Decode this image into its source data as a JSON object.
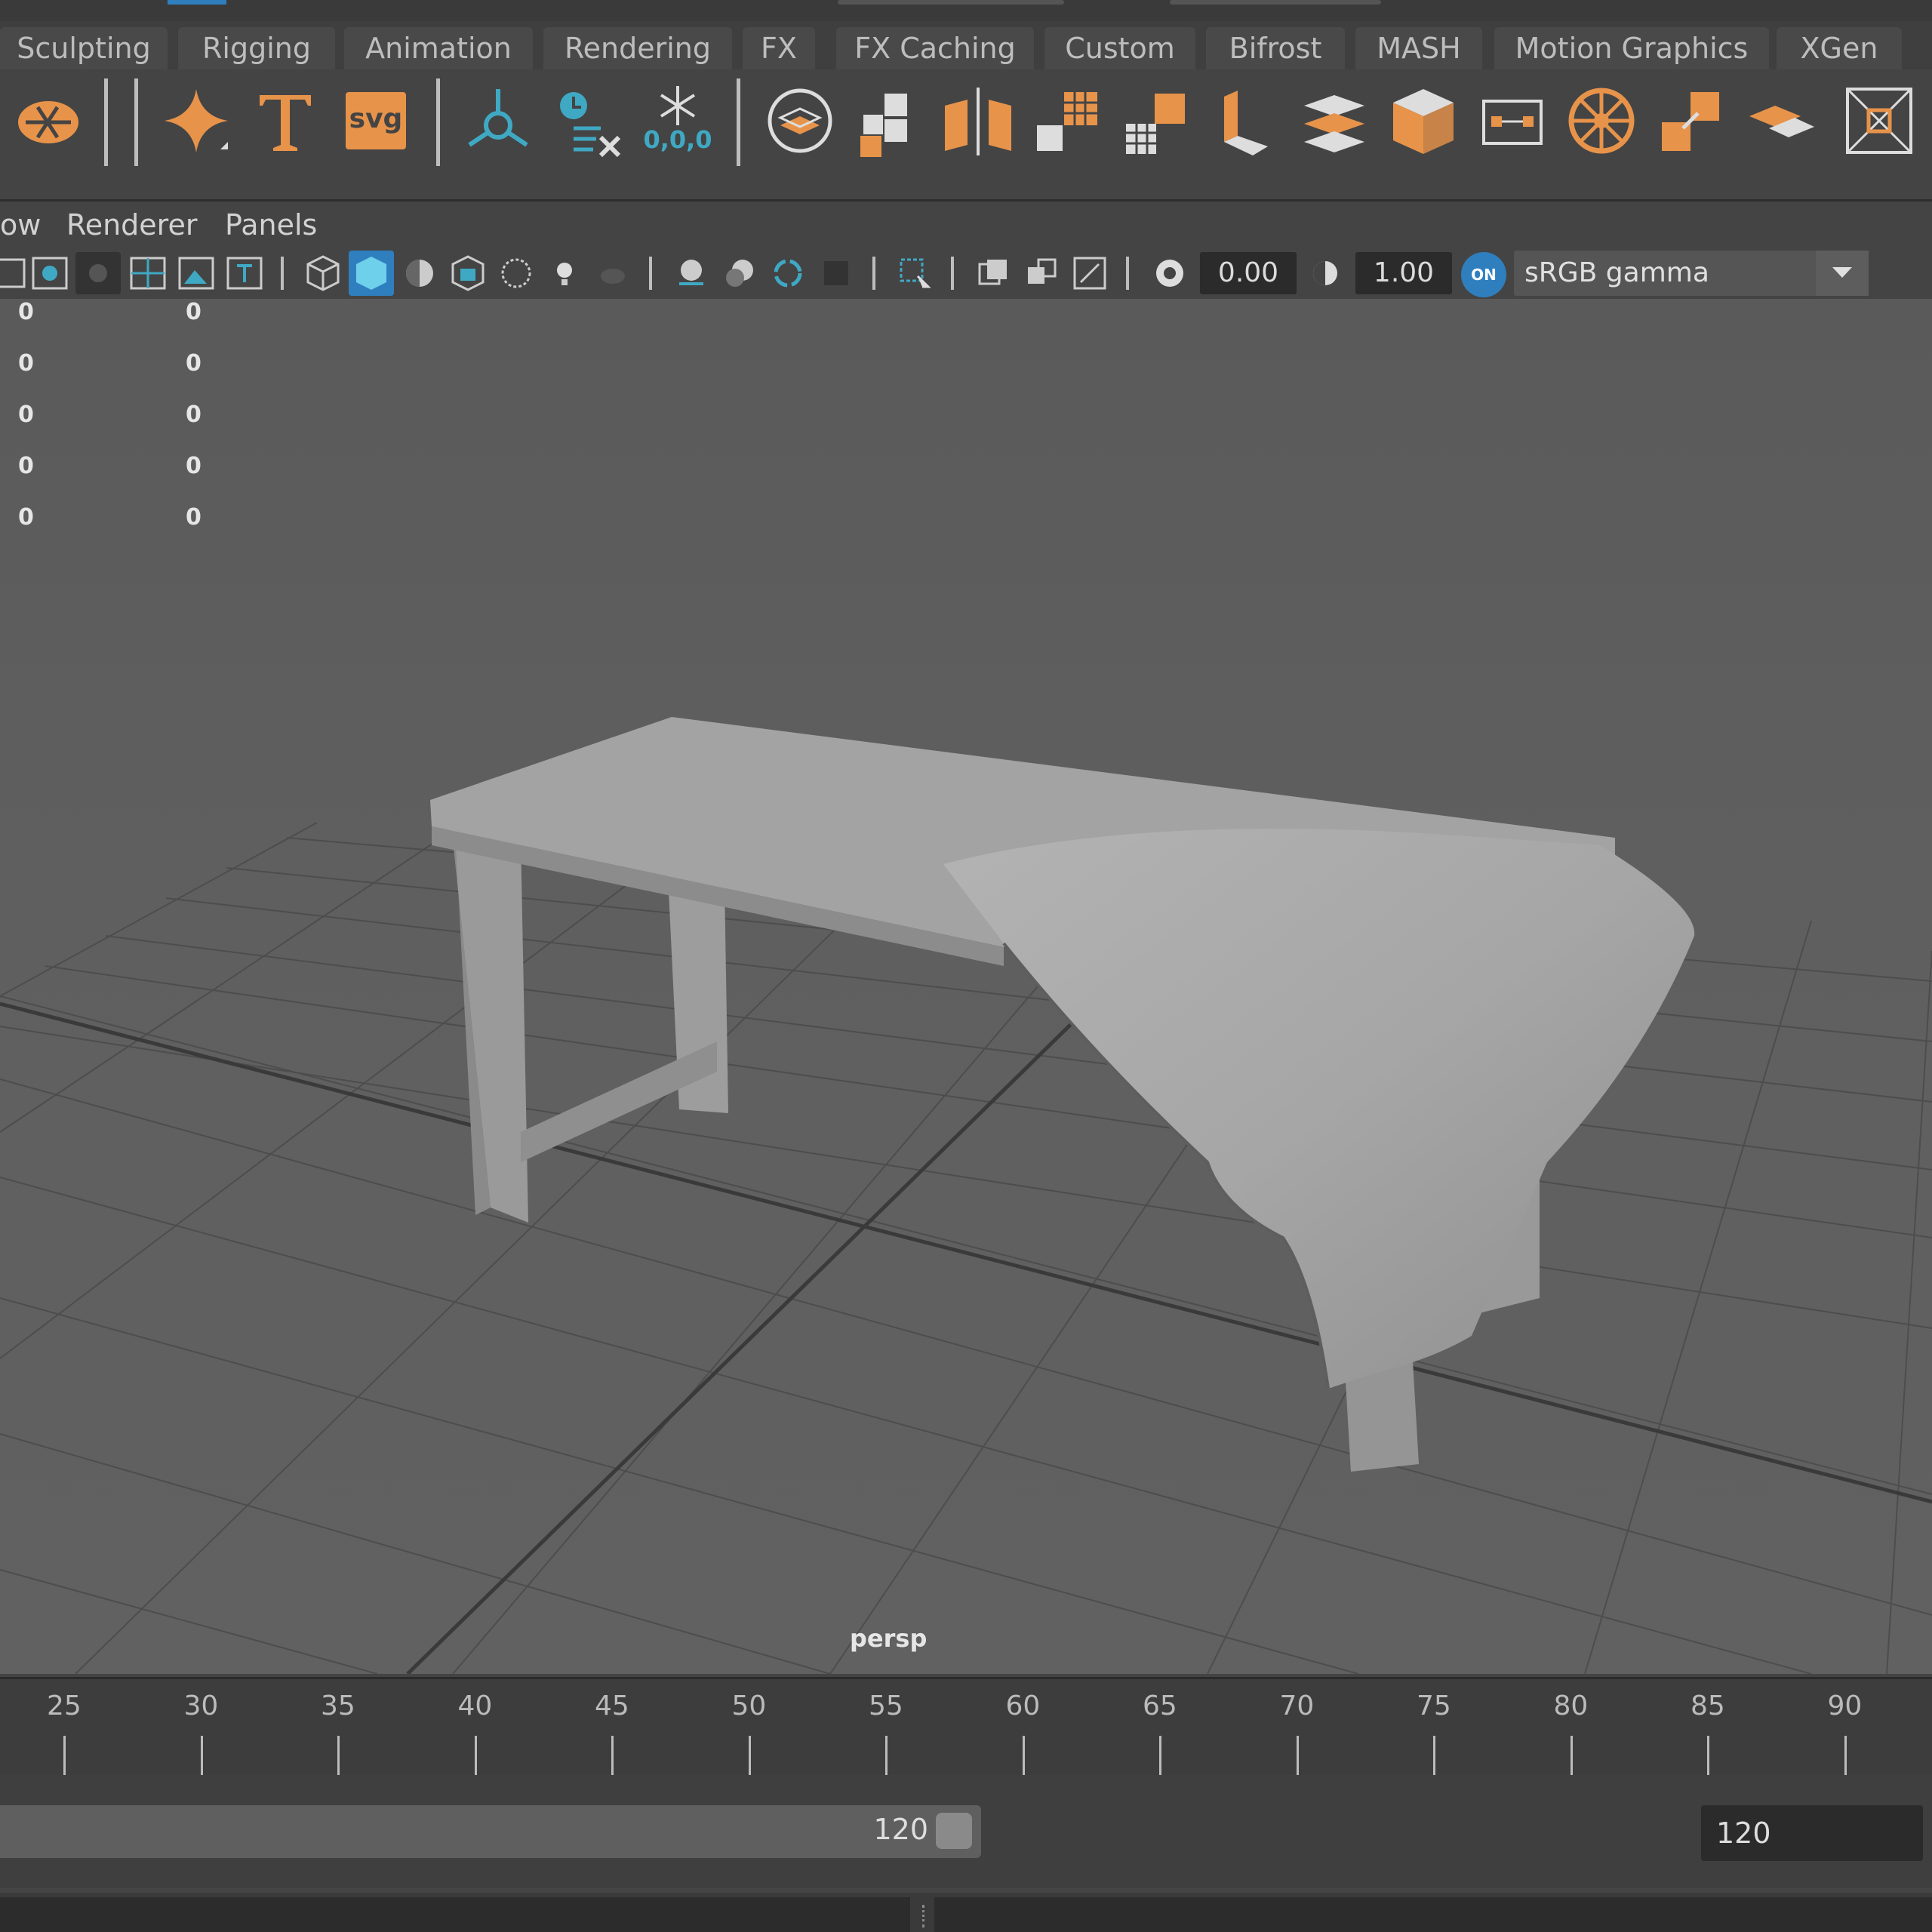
{
  "shelf_tabs": [
    "Sculpting",
    "Rigging",
    "Animation",
    "Rendering",
    "FX",
    "FX Caching",
    "Custom",
    "Bifrost",
    "MASH",
    "Motion Graphics",
    "XGen"
  ],
  "shelf_icons": [
    "sculpt-icon",
    "divider",
    "star-sparkle-icon",
    "text-type-icon",
    "svg-icon",
    "divider",
    "locator-icon",
    "clock-delete-icon",
    "snowflake-freeze-icon",
    "divider",
    "layer-sphere-icon",
    "tiles-icon",
    "mirror-cubes-icon",
    "grid-duplicate-icon",
    "stair-grid-icon",
    "extrude-column-icon",
    "stacked-planes-icon",
    "cube-icon",
    "bounding-box-icon",
    "wheel-icon",
    "cubes-scale-icon",
    "planes-icon",
    "frame-center-icon"
  ],
  "shelf_svg_label": "svg",
  "shelf_freeze_label": "0,0,0",
  "panel_menu": {
    "show": "ow",
    "renderer": "Renderer",
    "panels": "Panels"
  },
  "viewport_toolbar": {
    "exposure": "0.00",
    "gamma": "1.00",
    "on_badge": "ON",
    "colorspace": "sRGB gamma"
  },
  "hud": {
    "col1": [
      "0",
      "0",
      "0",
      "0",
      "0"
    ],
    "col2": [
      "0",
      "0",
      "0",
      "0",
      "0"
    ],
    "camera": "persp"
  },
  "timeline": {
    "ticks": [
      "25",
      "30",
      "35",
      "40",
      "45",
      "50",
      "55",
      "60",
      "65",
      "70",
      "75",
      "80",
      "85",
      "90"
    ]
  },
  "range": {
    "current_end": "120",
    "end_field": "120"
  },
  "colors": {
    "accent_orange": "#e8934a",
    "accent_teal": "#3fa9c4",
    "active_blue": "#2f7fbf"
  }
}
